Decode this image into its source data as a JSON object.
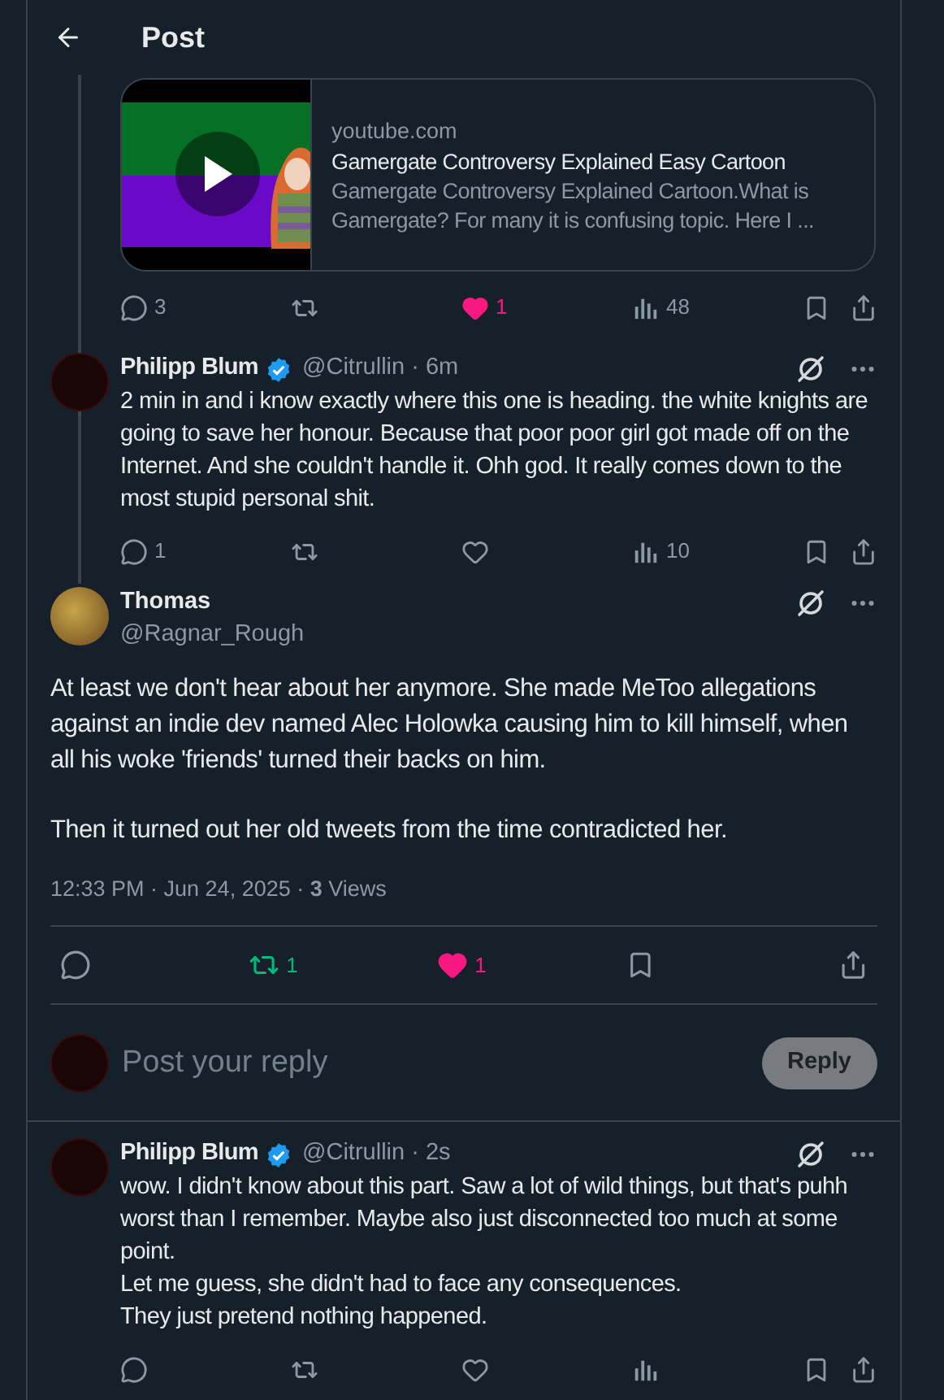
{
  "header": {
    "title": "Post"
  },
  "link_card": {
    "domain": "youtube.com",
    "title": "Gamergate Controversy Explained Easy Cartoon",
    "description": "Gamergate Controversy Explained Cartoon.What is Gamergate? For many it is confusing topic. Here I ..."
  },
  "parent_actions": [
    {
      "kind": "reply",
      "count": "3",
      "active": false
    },
    {
      "kind": "repost",
      "active": false
    },
    {
      "kind": "like",
      "count": "1",
      "active": true
    },
    {
      "kind": "views",
      "count": "48",
      "active": false
    }
  ],
  "thread_reply": {
    "name": "Philipp Blum",
    "verified": true,
    "handle": "@Citrullin · 6m",
    "text": "2 min in and i know exactly where this one is heading. the white knights are going to save her honour. Because that poor poor girl got made off on the Internet. And she couldn't handle it. Ohh god. It really comes down to the most stupid personal shit.",
    "actions": [
      {
        "kind": "reply",
        "count": "1",
        "active": false
      },
      {
        "kind": "repost",
        "active": false
      },
      {
        "kind": "like",
        "active": false
      },
      {
        "kind": "views",
        "count": "10",
        "active": false
      }
    ]
  },
  "main_post": {
    "name": "Thomas",
    "handle": "@Ragnar_Rough",
    "paragraphs": [
      "At least we don't hear about her anymore. She made MeToo allegations against an indie dev named Alec Holowka causing him to kill himself, when all his woke 'friends' turned their backs on him.",
      "Then it turned out her old tweets from the time contradicted her."
    ],
    "meta": "12:33 PM · Jun 24, 2025 · **3** Views",
    "actions": [
      {
        "kind": "reply",
        "active": false
      },
      {
        "kind": "repost",
        "count": "1",
        "active": true
      },
      {
        "kind": "like",
        "count": "1",
        "active": true
      }
    ]
  },
  "compose": {
    "placeholder": "Post your reply",
    "button": "Reply",
    "disabled": true
  },
  "replies": [
    {
      "name": "Philipp Blum",
      "verified": true,
      "handle": "@Citrullin · 2s",
      "text": "wow. I didn't know about this part. Saw a lot of wild things, but that's puhh worst than I remember. Maybe also just disconnected too much at some point.\nLet me guess, she didn't had to face any consequences.\nThey just pretend nothing happened.",
      "actions": [
        {
          "kind": "reply",
          "active": false
        },
        {
          "kind": "repost",
          "active": false
        },
        {
          "kind": "like",
          "active": false
        },
        {
          "kind": "views",
          "active": false
        }
      ]
    }
  ]
}
